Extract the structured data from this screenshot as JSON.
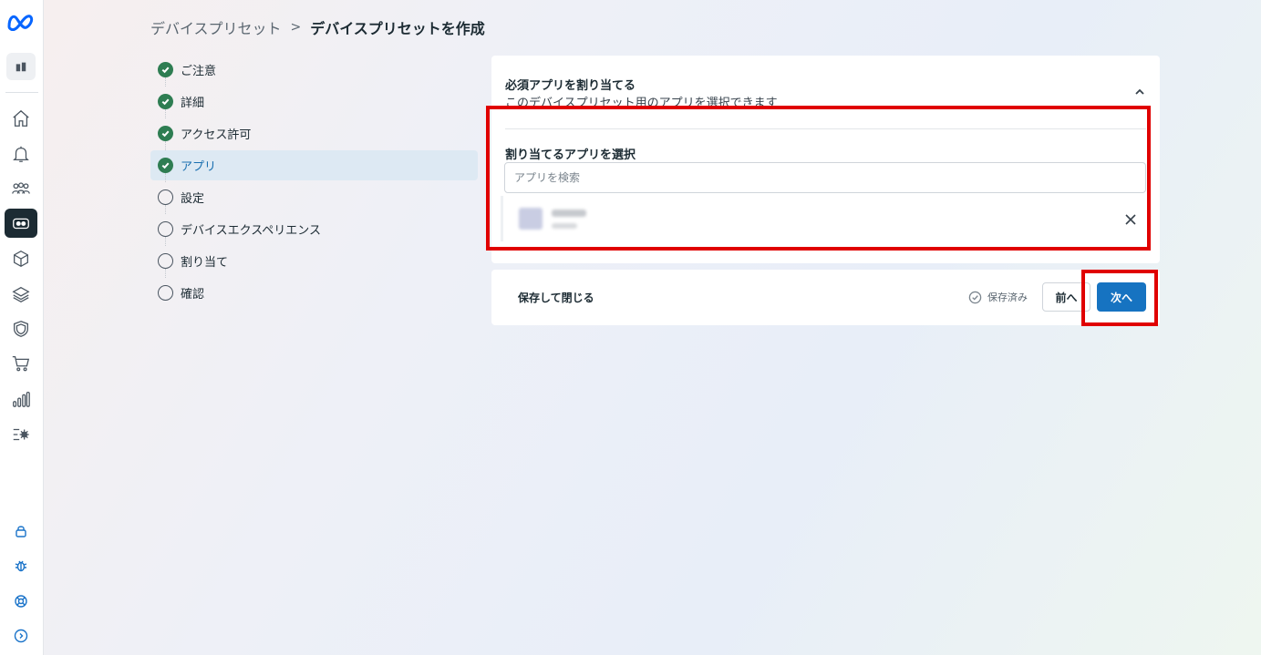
{
  "sidebar": {
    "logo": "meta-logo-icon",
    "org": "building-icon",
    "items": [
      {
        "icon": "home-icon"
      },
      {
        "icon": "bell-icon"
      },
      {
        "icon": "users-icon"
      },
      {
        "icon": "headset-icon",
        "active": true
      },
      {
        "icon": "cube-icon"
      },
      {
        "icon": "layers-icon"
      },
      {
        "icon": "shield-icon"
      },
      {
        "icon": "cart-icon"
      },
      {
        "icon": "bar-chart-icon"
      },
      {
        "icon": "settings-list-icon"
      }
    ],
    "bottom_items": [
      {
        "icon": "lock-icon"
      },
      {
        "icon": "bug-icon"
      },
      {
        "icon": "lifebuoy-icon"
      },
      {
        "icon": "expand-icon"
      }
    ]
  },
  "breadcrumb": {
    "parent": "デバイスプリセット",
    "separator": ">",
    "current": "デバイスプリセットを作成"
  },
  "steps": [
    {
      "label": "ご注意",
      "status": "done"
    },
    {
      "label": "詳細",
      "status": "done"
    },
    {
      "label": "アクセス許可",
      "status": "done"
    },
    {
      "label": "アプリ",
      "status": "current"
    },
    {
      "label": "設定",
      "status": "todo"
    },
    {
      "label": "デバイスエクスペリエンス",
      "status": "todo"
    },
    {
      "label": "割り当て",
      "status": "todo"
    },
    {
      "label": "確認",
      "status": "todo"
    }
  ],
  "card": {
    "title": "必須アプリを割り当てる",
    "subtitle": "このデバイスプリセット用のアプリを選択できます",
    "select_label": "割り当てるアプリを選択",
    "search_placeholder": "アプリを検索"
  },
  "footer": {
    "save_close": "保存して閉じる",
    "saved_status": "保存済み",
    "prev": "前へ",
    "next": "次へ"
  },
  "colors": {
    "accent": "#1673c1",
    "done": "#2e7d52",
    "highlight": "#e00000"
  }
}
